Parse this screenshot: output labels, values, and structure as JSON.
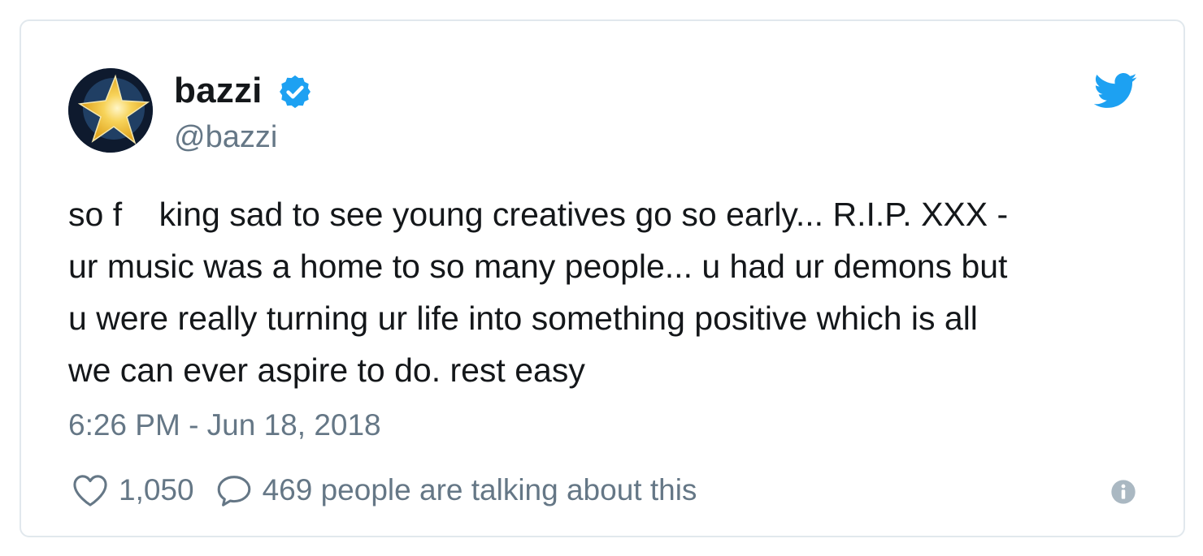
{
  "tweet": {
    "display_name": "bazzi",
    "handle": "@bazzi",
    "text": "so f    king sad to see young creatives go so early... R.I.P. XXX -\nur music was a home to so many people... u had ur demons but\nu were really turning ur life into something positive which is all\nwe can ever aspire to do. rest easy",
    "timestamp": "6:26 PM - Jun 18, 2018",
    "like_count": "1,050",
    "talking_text": "469 people are talking about this"
  },
  "icons": {
    "avatar": "star-avatar",
    "verified": "verified-badge-icon",
    "brand": "twitter-bird-icon",
    "like": "heart-outline-icon",
    "reply": "speech-bubble-icon",
    "info": "info-icon"
  },
  "colors": {
    "brand_blue": "#1da1f2",
    "text": "#14171a",
    "secondary_text": "#657786",
    "border": "#e1e8ed",
    "info_gray": "#aab8c2"
  }
}
